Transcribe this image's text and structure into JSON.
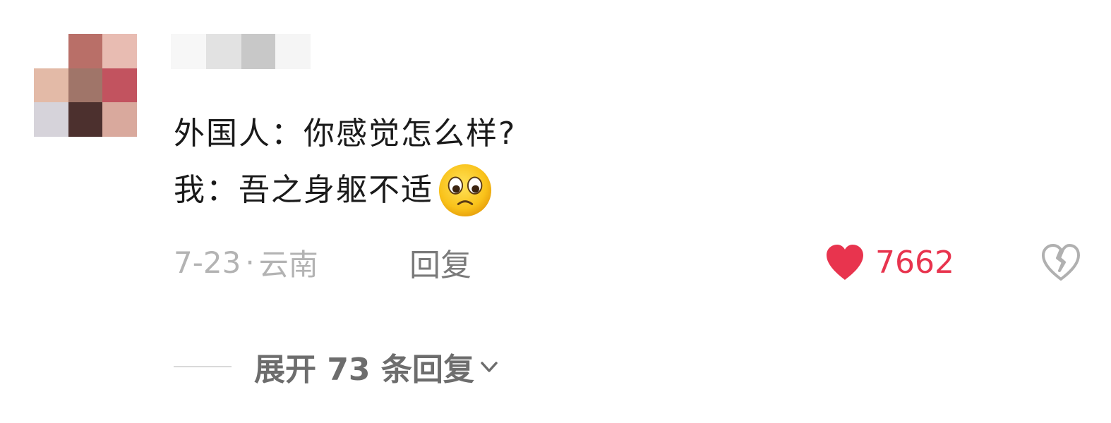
{
  "avatar": {
    "pixels": [
      "#ffffff",
      "#b96f68",
      "#e8bcb2",
      "#e3baa7",
      "#a07569",
      "#c2535f",
      "#d6d3da",
      "#4c302e",
      "#d9a99d"
    ]
  },
  "username": {
    "blocks": [
      "#f7f7f7",
      "#e2e2e2",
      "#c8c8c8",
      "#f5f5f5"
    ]
  },
  "comment": {
    "line1": "外国人：你感觉怎么样?",
    "line2": "我：吾之身躯不适"
  },
  "meta": {
    "date": "7-23",
    "separator": "·",
    "location": "云南",
    "reply_label": "回复"
  },
  "like": {
    "count": "7662",
    "color": "#e8344e"
  },
  "expand": {
    "label": "展开 73 条回复"
  },
  "icons": {
    "emoji": "worried-face-icon",
    "like": "heart-icon",
    "dislike": "broken-heart-icon",
    "expand": "chevron-down-icon"
  }
}
